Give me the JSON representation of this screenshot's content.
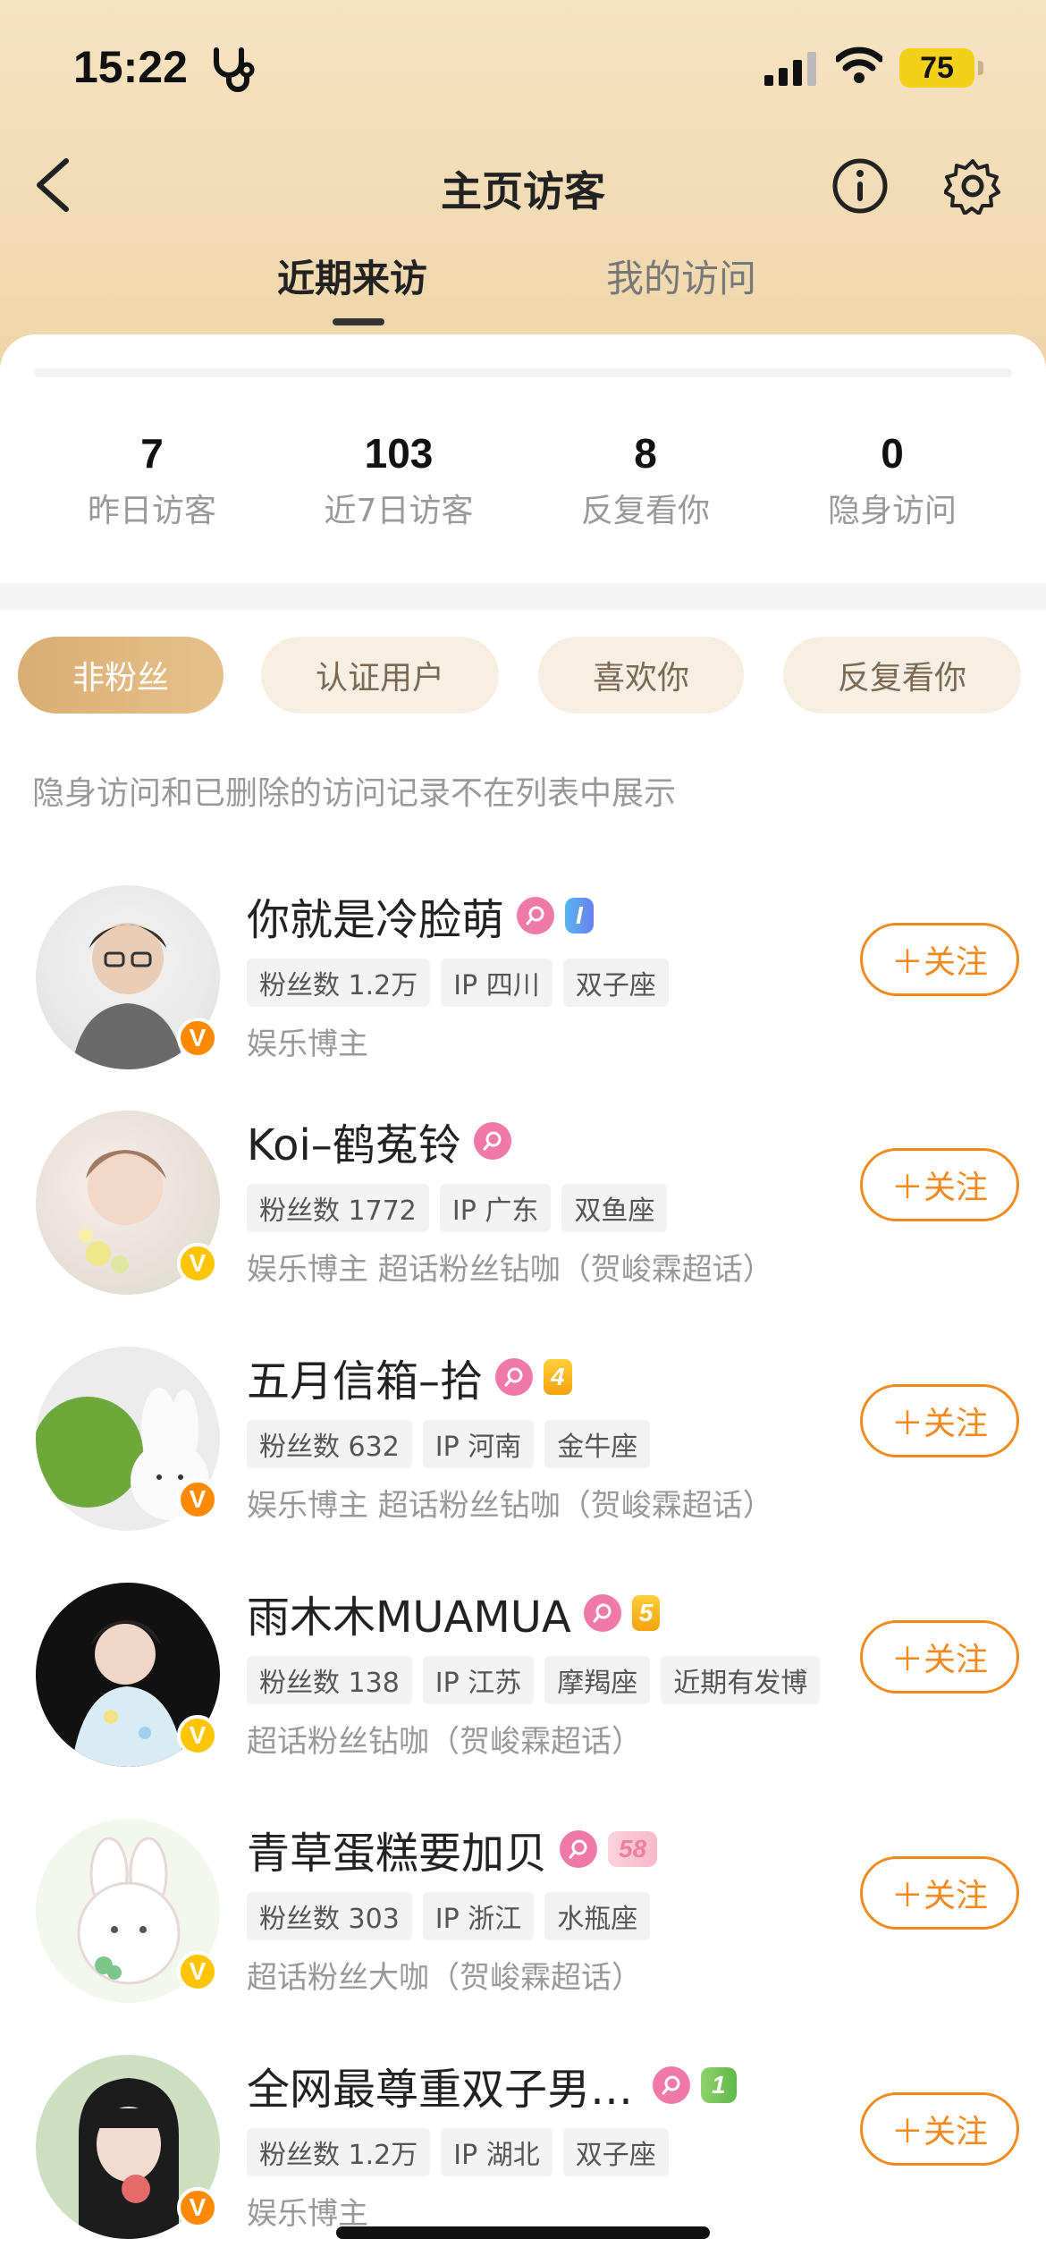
{
  "status_bar": {
    "time": "15:22",
    "battery": "75"
  },
  "nav": {
    "title": "主页访客"
  },
  "tabs": [
    {
      "label": "近期来访",
      "active": true
    },
    {
      "label": "我的访问",
      "active": false
    }
  ],
  "stats": [
    {
      "value": "7",
      "label": "昨日访客"
    },
    {
      "value": "103",
      "label": "近7日访客"
    },
    {
      "value": "8",
      "label": "反复看你"
    },
    {
      "value": "0",
      "label": "隐身访问"
    }
  ],
  "filters": [
    {
      "label": "非粉丝",
      "active": true
    },
    {
      "label": "认证用户",
      "active": false
    },
    {
      "label": "喜欢你",
      "active": false
    },
    {
      "label": "反复看你",
      "active": false
    }
  ],
  "hint": "隐身访问和已删除的访问记录不在列表中展示",
  "follow_label": "＋关注",
  "visitors": [
    {
      "name": "你就是冷脸萌",
      "level_badge": "I",
      "tags": [
        "粉丝数 1.2万",
        "IP 四川",
        "双子座"
      ],
      "desc": "娱乐博主"
    },
    {
      "name": "Koi–鹤菟铃",
      "tags": [
        "粉丝数 1772",
        "IP 广东",
        "双鱼座"
      ],
      "desc": "娱乐博主 超话粉丝钻咖（贺峻霖超话）"
    },
    {
      "name": "五月信箱–拾",
      "level_badge": "4",
      "tags": [
        "粉丝数 632",
        "IP 河南",
        "金牛座"
      ],
      "desc": "娱乐博主 超话粉丝钻咖（贺峻霖超话）"
    },
    {
      "name": "雨木木MUAMUA",
      "level_badge": "5",
      "tags": [
        "粉丝数 138",
        "IP 江苏",
        "摩羯座",
        "近期有发博"
      ],
      "desc": "超话粉丝钻咖（贺峻霖超话）"
    },
    {
      "name": "青草蛋糕要加贝",
      "level_badge": "58",
      "tags": [
        "粉丝数 303",
        "IP 浙江",
        "水瓶座"
      ],
      "desc": "超话粉丝大咖（贺峻霖超话）"
    },
    {
      "name": "全网最尊重双子男…",
      "level_badge": "1",
      "tags": [
        "粉丝数 1.2万",
        "IP 湖北",
        "双子座"
      ],
      "desc": "娱乐博主"
    }
  ],
  "colors": {
    "accent": "#f08a1e",
    "chip_active": "#dcb27a",
    "fan_badge": "#ef7aa7"
  }
}
